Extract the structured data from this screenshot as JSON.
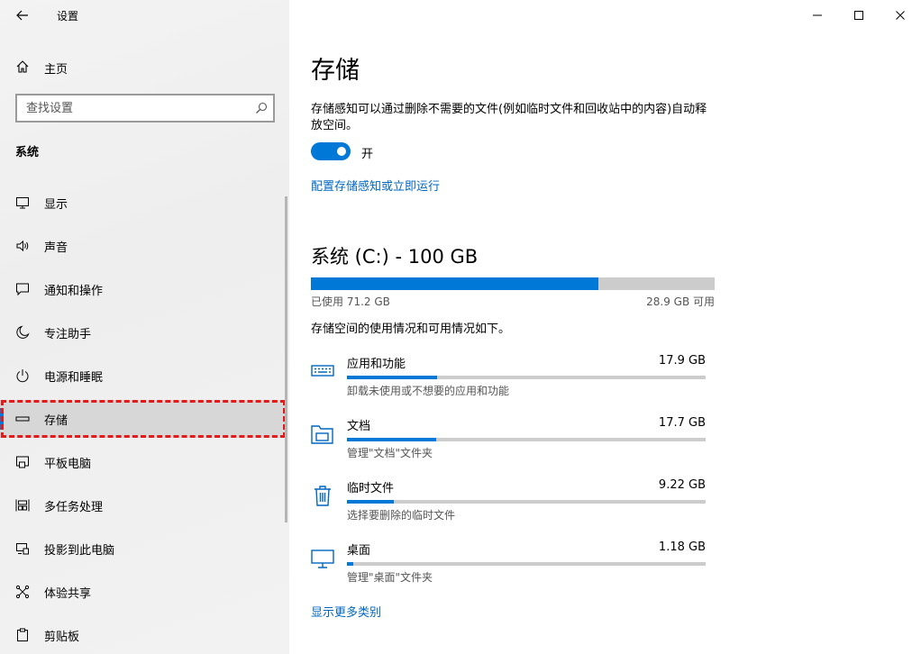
{
  "app_title": "设置",
  "sidebar": {
    "home_label": "主页",
    "search_placeholder": "查找设置",
    "section_title": "系统",
    "items": [
      {
        "label": "显示",
        "icon": "monitor-icon"
      },
      {
        "label": "声音",
        "icon": "speaker-icon"
      },
      {
        "label": "通知和操作",
        "icon": "message-icon"
      },
      {
        "label": "专注助手",
        "icon": "moon-icon"
      },
      {
        "label": "电源和睡眠",
        "icon": "power-icon"
      },
      {
        "label": "存储",
        "icon": "storage-icon",
        "selected": true
      },
      {
        "label": "平板电脑",
        "icon": "tablet-icon"
      },
      {
        "label": "多任务处理",
        "icon": "multitask-icon"
      },
      {
        "label": "投影到此电脑",
        "icon": "project-icon"
      },
      {
        "label": "体验共享",
        "icon": "share-icon"
      },
      {
        "label": "剪贴板",
        "icon": "clipboard-icon"
      }
    ]
  },
  "main": {
    "title": "存储",
    "description": "存储感知可以通过删除不需要的文件(例如临时文件和回收站中的内容)自动释放空间。",
    "toggle_state_label": "开",
    "configure_link": "配置存储感知或立即运行",
    "drive": {
      "title": "系统 (C:) - 100 GB",
      "used_label": "已使用 71.2 GB",
      "free_label": "28.9 GB 可用",
      "used_fraction": 0.712
    },
    "usage_description": "存储空间的使用情况和可用情况如下。",
    "categories": [
      {
        "name": "应用和功能",
        "size": "17.9 GB",
        "sub": "卸载未使用或不想要的应用和功能",
        "fraction": 0.25,
        "icon": "keyboard-icon"
      },
      {
        "name": "文档",
        "size": "17.7 GB",
        "sub": "管理\"文档\"文件夹",
        "fraction": 0.248,
        "icon": "folder-icon"
      },
      {
        "name": "临时文件",
        "size": "9.22 GB",
        "sub": "选择要删除的临时文件",
        "fraction": 0.13,
        "icon": "trash-icon"
      },
      {
        "name": "桌面",
        "size": "1.18 GB",
        "sub": "管理\"桌面\"文件夹",
        "fraction": 0.017,
        "icon": "desktop-icon"
      }
    ],
    "more_link": "显示更多类别"
  },
  "colors": {
    "accent": "#0078d7",
    "link": "#0067c0",
    "highlight": "#e21a1a"
  }
}
